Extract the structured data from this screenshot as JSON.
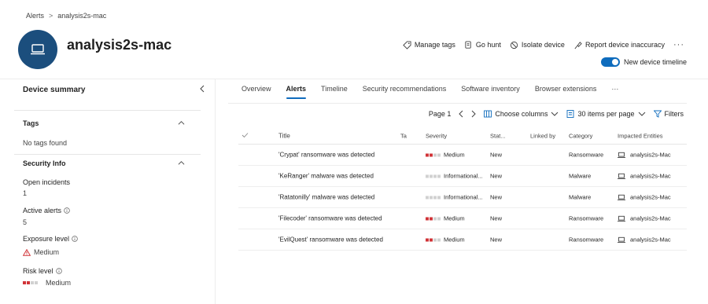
{
  "breadcrumb": {
    "root": "Alerts",
    "separator": ">",
    "current": "analysis2s-mac"
  },
  "device": {
    "name": "analysis2s-mac",
    "avatar_icon": "laptop-icon",
    "avatar_color": "#1b4e7d"
  },
  "actions": [
    {
      "label": "Manage tags",
      "icon": "tag-icon"
    },
    {
      "label": "Go hunt",
      "icon": "hunt-icon"
    },
    {
      "label": "Isolate device",
      "icon": "isolate-icon"
    },
    {
      "label": "Report device inaccuracy",
      "icon": "report-icon"
    }
  ],
  "more_label": "···",
  "timeline_toggle": {
    "label": "New device timeline",
    "on": true
  },
  "summary": {
    "title": "Device summary",
    "tags_section": "Tags",
    "tags_empty": "No tags found",
    "security_section": "Security Info",
    "open_incidents_label": "Open incidents",
    "open_incidents_value": "1",
    "active_alerts_label": "Active alerts",
    "active_alerts_value": "5",
    "exposure_label": "Exposure level",
    "exposure_value": "Medium",
    "risk_label": "Risk level",
    "risk_value": "Medium"
  },
  "tabs": [
    "Overview",
    "Alerts",
    "Timeline",
    "Security recommendations",
    "Software inventory",
    "Browser extensions"
  ],
  "active_tab": "Alerts",
  "tabs_more": "···",
  "toolbar": {
    "page_label": "Page 1",
    "choose_columns": "Choose columns",
    "items_per_page": "30 items per page",
    "filters": "Filters"
  },
  "table": {
    "headers": {
      "title": "Title",
      "ta": "Ta",
      "severity": "Severity",
      "status": "Stat...",
      "linked_by": "Linked by",
      "category": "Category",
      "entities": "Impacted Entities"
    },
    "rows": [
      {
        "title": "'Crypat' ransomware was detected",
        "severity": "Medium",
        "sev_level": 2,
        "status": "New",
        "category": "Ransomware",
        "entity": "analysis2s-Mac"
      },
      {
        "title": "'KeRanger' malware was detected",
        "severity": "Informational...",
        "sev_level": 0,
        "status": "New",
        "category": "Malware",
        "entity": "analysis2s-Mac"
      },
      {
        "title": "'Ratatonilly' malware was detected",
        "severity": "Informational...",
        "sev_level": 0,
        "status": "New",
        "category": "Malware",
        "entity": "analysis2s-Mac"
      },
      {
        "title": "'Filecoder' ransomware was detected",
        "severity": "Medium",
        "sev_level": 2,
        "status": "New",
        "category": "Ransomware",
        "entity": "analysis2s-Mac"
      },
      {
        "title": "'EvilQuest' ransomware was detected",
        "severity": "Medium",
        "sev_level": 2,
        "status": "New",
        "category": "Ransomware",
        "entity": "analysis2s-Mac"
      }
    ]
  },
  "colors": {
    "accent": "#0f6cbd",
    "severity_medium": "#d13438",
    "severity_off": "#d1d1d1"
  }
}
